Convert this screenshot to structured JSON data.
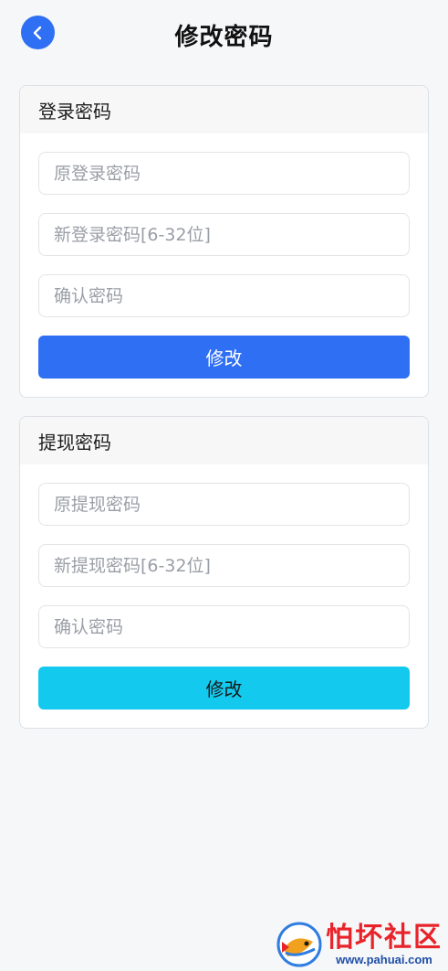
{
  "header": {
    "title": "修改密码",
    "back_icon": "chevron-left-icon",
    "accent_color": "#2f6ff4"
  },
  "login_password": {
    "title": "登录密码",
    "old_placeholder": "原登录密码",
    "new_placeholder": "新登录密码[6-32位]",
    "confirm_placeholder": "确认密码",
    "submit_label": "修改",
    "button_color": "#2f6ff4"
  },
  "withdraw_password": {
    "title": "提现密码",
    "old_placeholder": "原提现密码",
    "new_placeholder": "新提现密码[6-32位]",
    "confirm_placeholder": "确认密码",
    "submit_label": "修改",
    "button_color": "#13c9ee"
  },
  "watermark": {
    "name": "怕坏社区",
    "url": "www.pahuai.com",
    "color": "#e8242a"
  }
}
